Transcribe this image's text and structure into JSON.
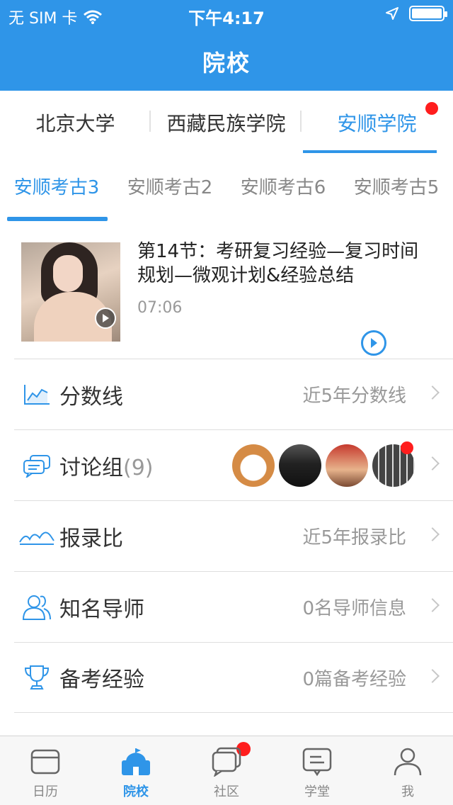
{
  "status_bar": {
    "carrier": "无 SIM 卡",
    "time": "下午4:17"
  },
  "header": {
    "title": "院校"
  },
  "school_tabs": [
    {
      "label": "北京大学",
      "active": false
    },
    {
      "label": "西藏民族学院",
      "active": false
    },
    {
      "label": "安顺学院",
      "active": true,
      "badge": true
    }
  ],
  "sub_tabs": [
    {
      "label": "安顺考古3",
      "active": true
    },
    {
      "label": "安顺考古2",
      "active": false
    },
    {
      "label": "安顺考古6",
      "active": false
    },
    {
      "label": "安顺考古5",
      "active": false
    }
  ],
  "video": {
    "title": "第14节：考研复习经验—复习时间规划—微观计划&经验总结",
    "duration": "07:06"
  },
  "list": {
    "score": {
      "label": "分数线",
      "value": "近5年分数线",
      "icon": "line-chart-icon"
    },
    "discussion": {
      "label": "讨论组",
      "count": "(9)",
      "icon": "chat-bubbles-icon"
    },
    "ratio": {
      "label": "报录比",
      "value": "近5年报录比",
      "icon": "wave-chart-icon"
    },
    "mentors": {
      "label": "知名导师",
      "value": "0名导师信息",
      "icon": "users-icon"
    },
    "experience": {
      "label": "备考经验",
      "value": "0篇备考经验",
      "icon": "trophy-icon"
    }
  },
  "tabbar": [
    {
      "label": "日历",
      "icon": "calendar-icon",
      "active": false
    },
    {
      "label": "院校",
      "icon": "school-icon",
      "active": true,
      "badge": true
    },
    {
      "label": "社区",
      "icon": "community-icon",
      "active": false
    },
    {
      "label": "学堂",
      "icon": "classroom-icon",
      "active": false
    },
    {
      "label": "我",
      "icon": "profile-icon",
      "active": false
    }
  ],
  "colors": {
    "accent": "#2f95e8",
    "badge": "#ff1d1d"
  }
}
